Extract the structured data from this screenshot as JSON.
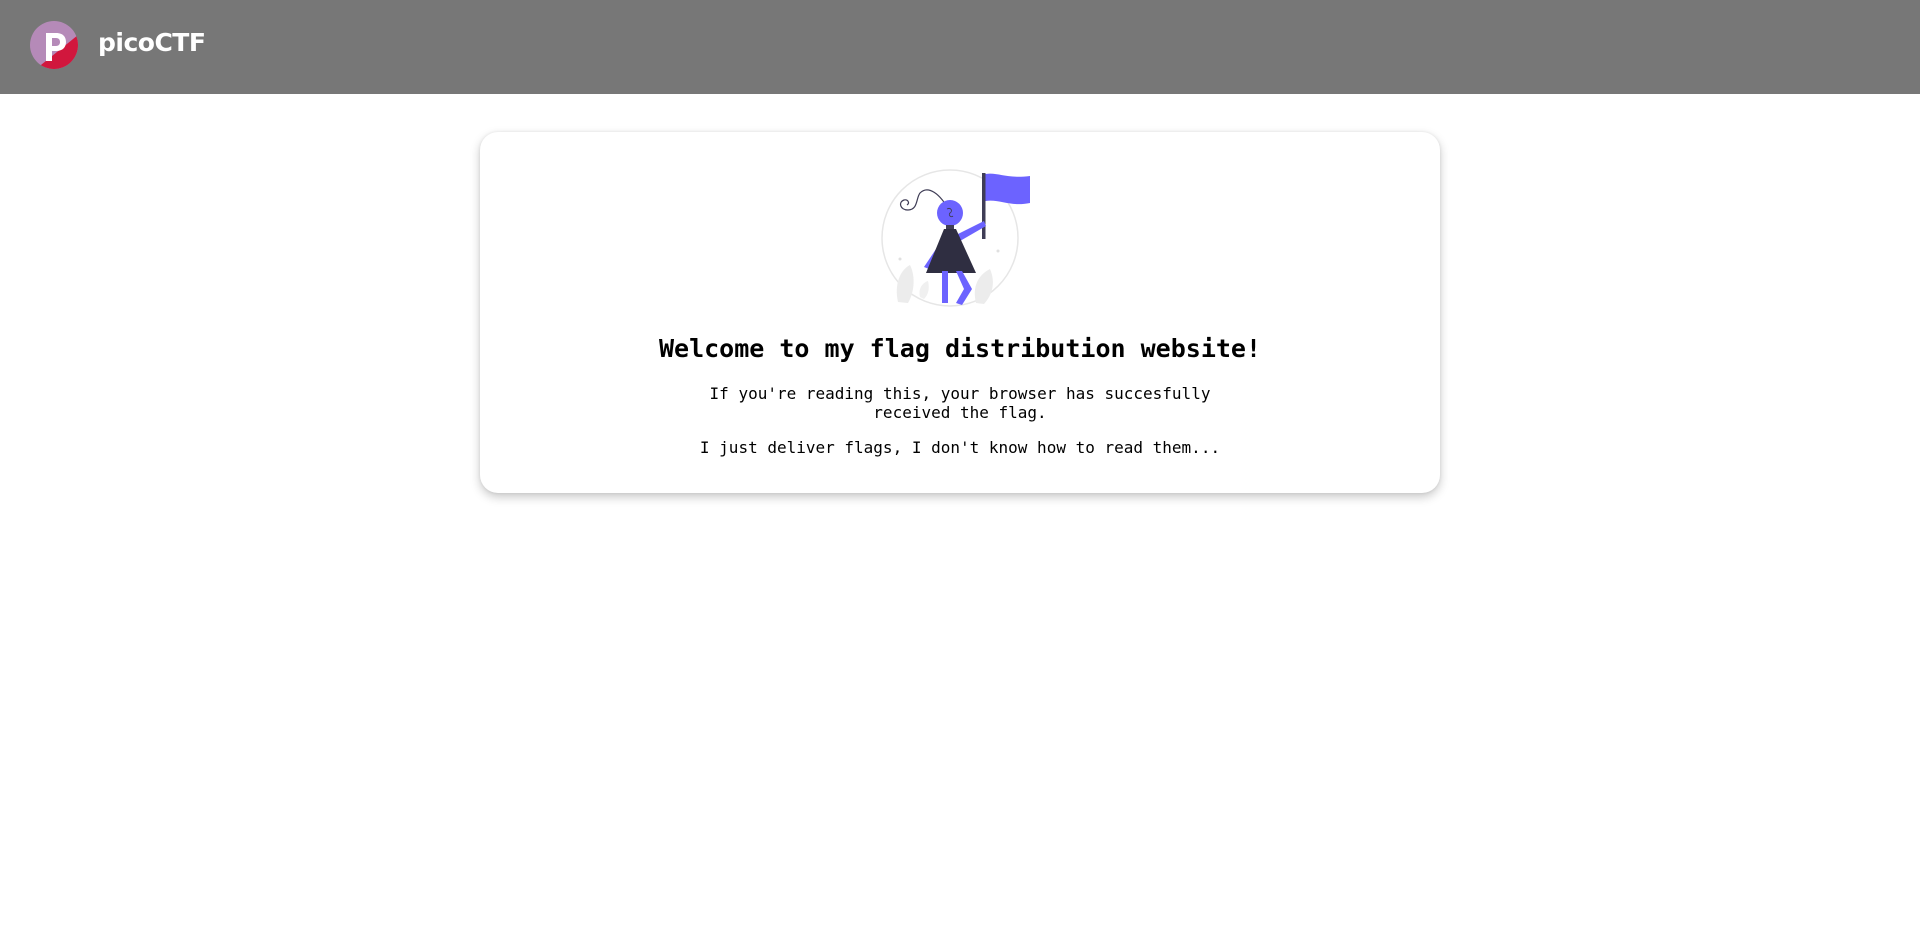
{
  "header": {
    "brand": "picoCTF",
    "logo_icon": "picoctf-logo-icon",
    "background_color": "#777777"
  },
  "card": {
    "illustration_icon": "person-with-flag-icon",
    "accent_color": "#6c63ff",
    "heading": "Welcome to my flag distribution website!",
    "message_line1": "If you're reading this, your browser has succesfully",
    "message_line2": "received the flag.",
    "message2": "I just deliver flags, I don't know how to read them..."
  }
}
